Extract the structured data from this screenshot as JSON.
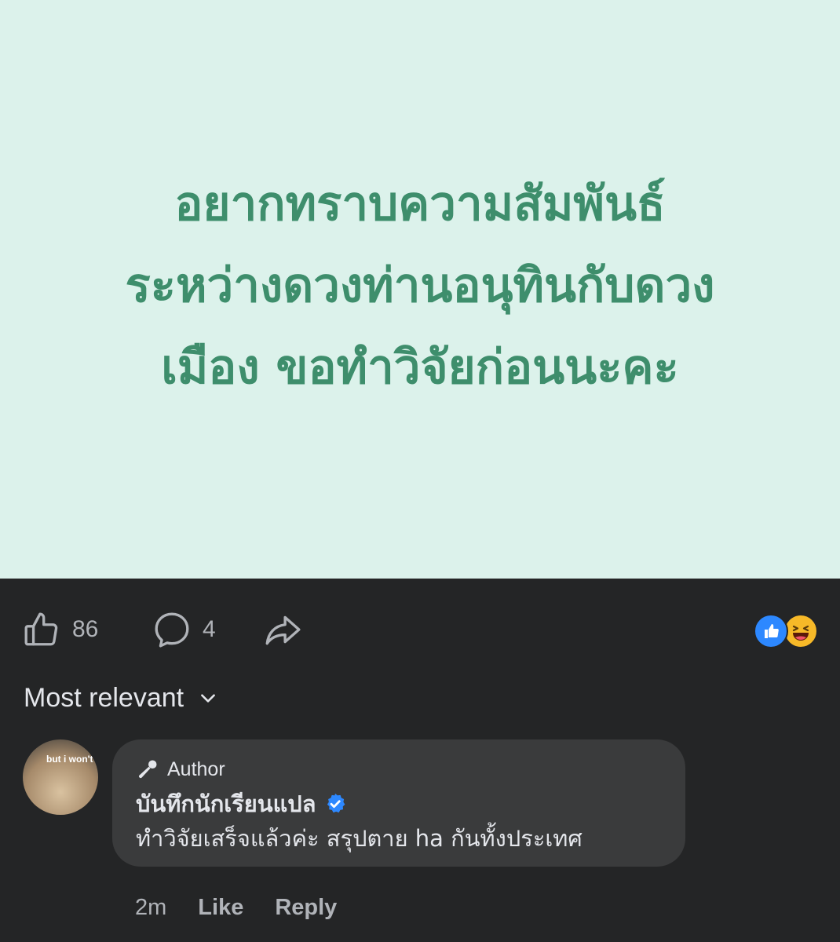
{
  "post": {
    "text_line1": "อยากทราบความสัมพันธ์",
    "text_line2": "ระหว่างดวงท่านอนุทินกับดวง",
    "text_line3": "เมือง ขอทำวิจัยก่อนนะคะ",
    "background_color": "#dcf2eb",
    "text_color": "#3e8e6c"
  },
  "actions": {
    "like_count": "86",
    "comment_count": "4",
    "like_icon": "thumbs-up-icon",
    "comment_icon": "comment-bubble-icon",
    "share_icon": "share-arrow-icon"
  },
  "reactions": [
    "like",
    "haha"
  ],
  "sort": {
    "label": "Most relevant",
    "icon": "chevron-down-icon"
  },
  "comment": {
    "avatar_caption": "but i won't",
    "badge_label": "Author",
    "badge_icon": "microphone-icon",
    "author_name": "บันทึกนักเรียนแปล",
    "verified_icon": "verified-badge-icon",
    "text": "ทำวิจัยเสร็จแล้วค่ะ สรุปตาย ha กันทั้งประเทศ",
    "time": "2m",
    "like_label": "Like",
    "reply_label": "Reply"
  },
  "colors": {
    "dark_background": "#242526",
    "bubble": "#3a3b3c",
    "accent_blue": "#2d88ff"
  }
}
